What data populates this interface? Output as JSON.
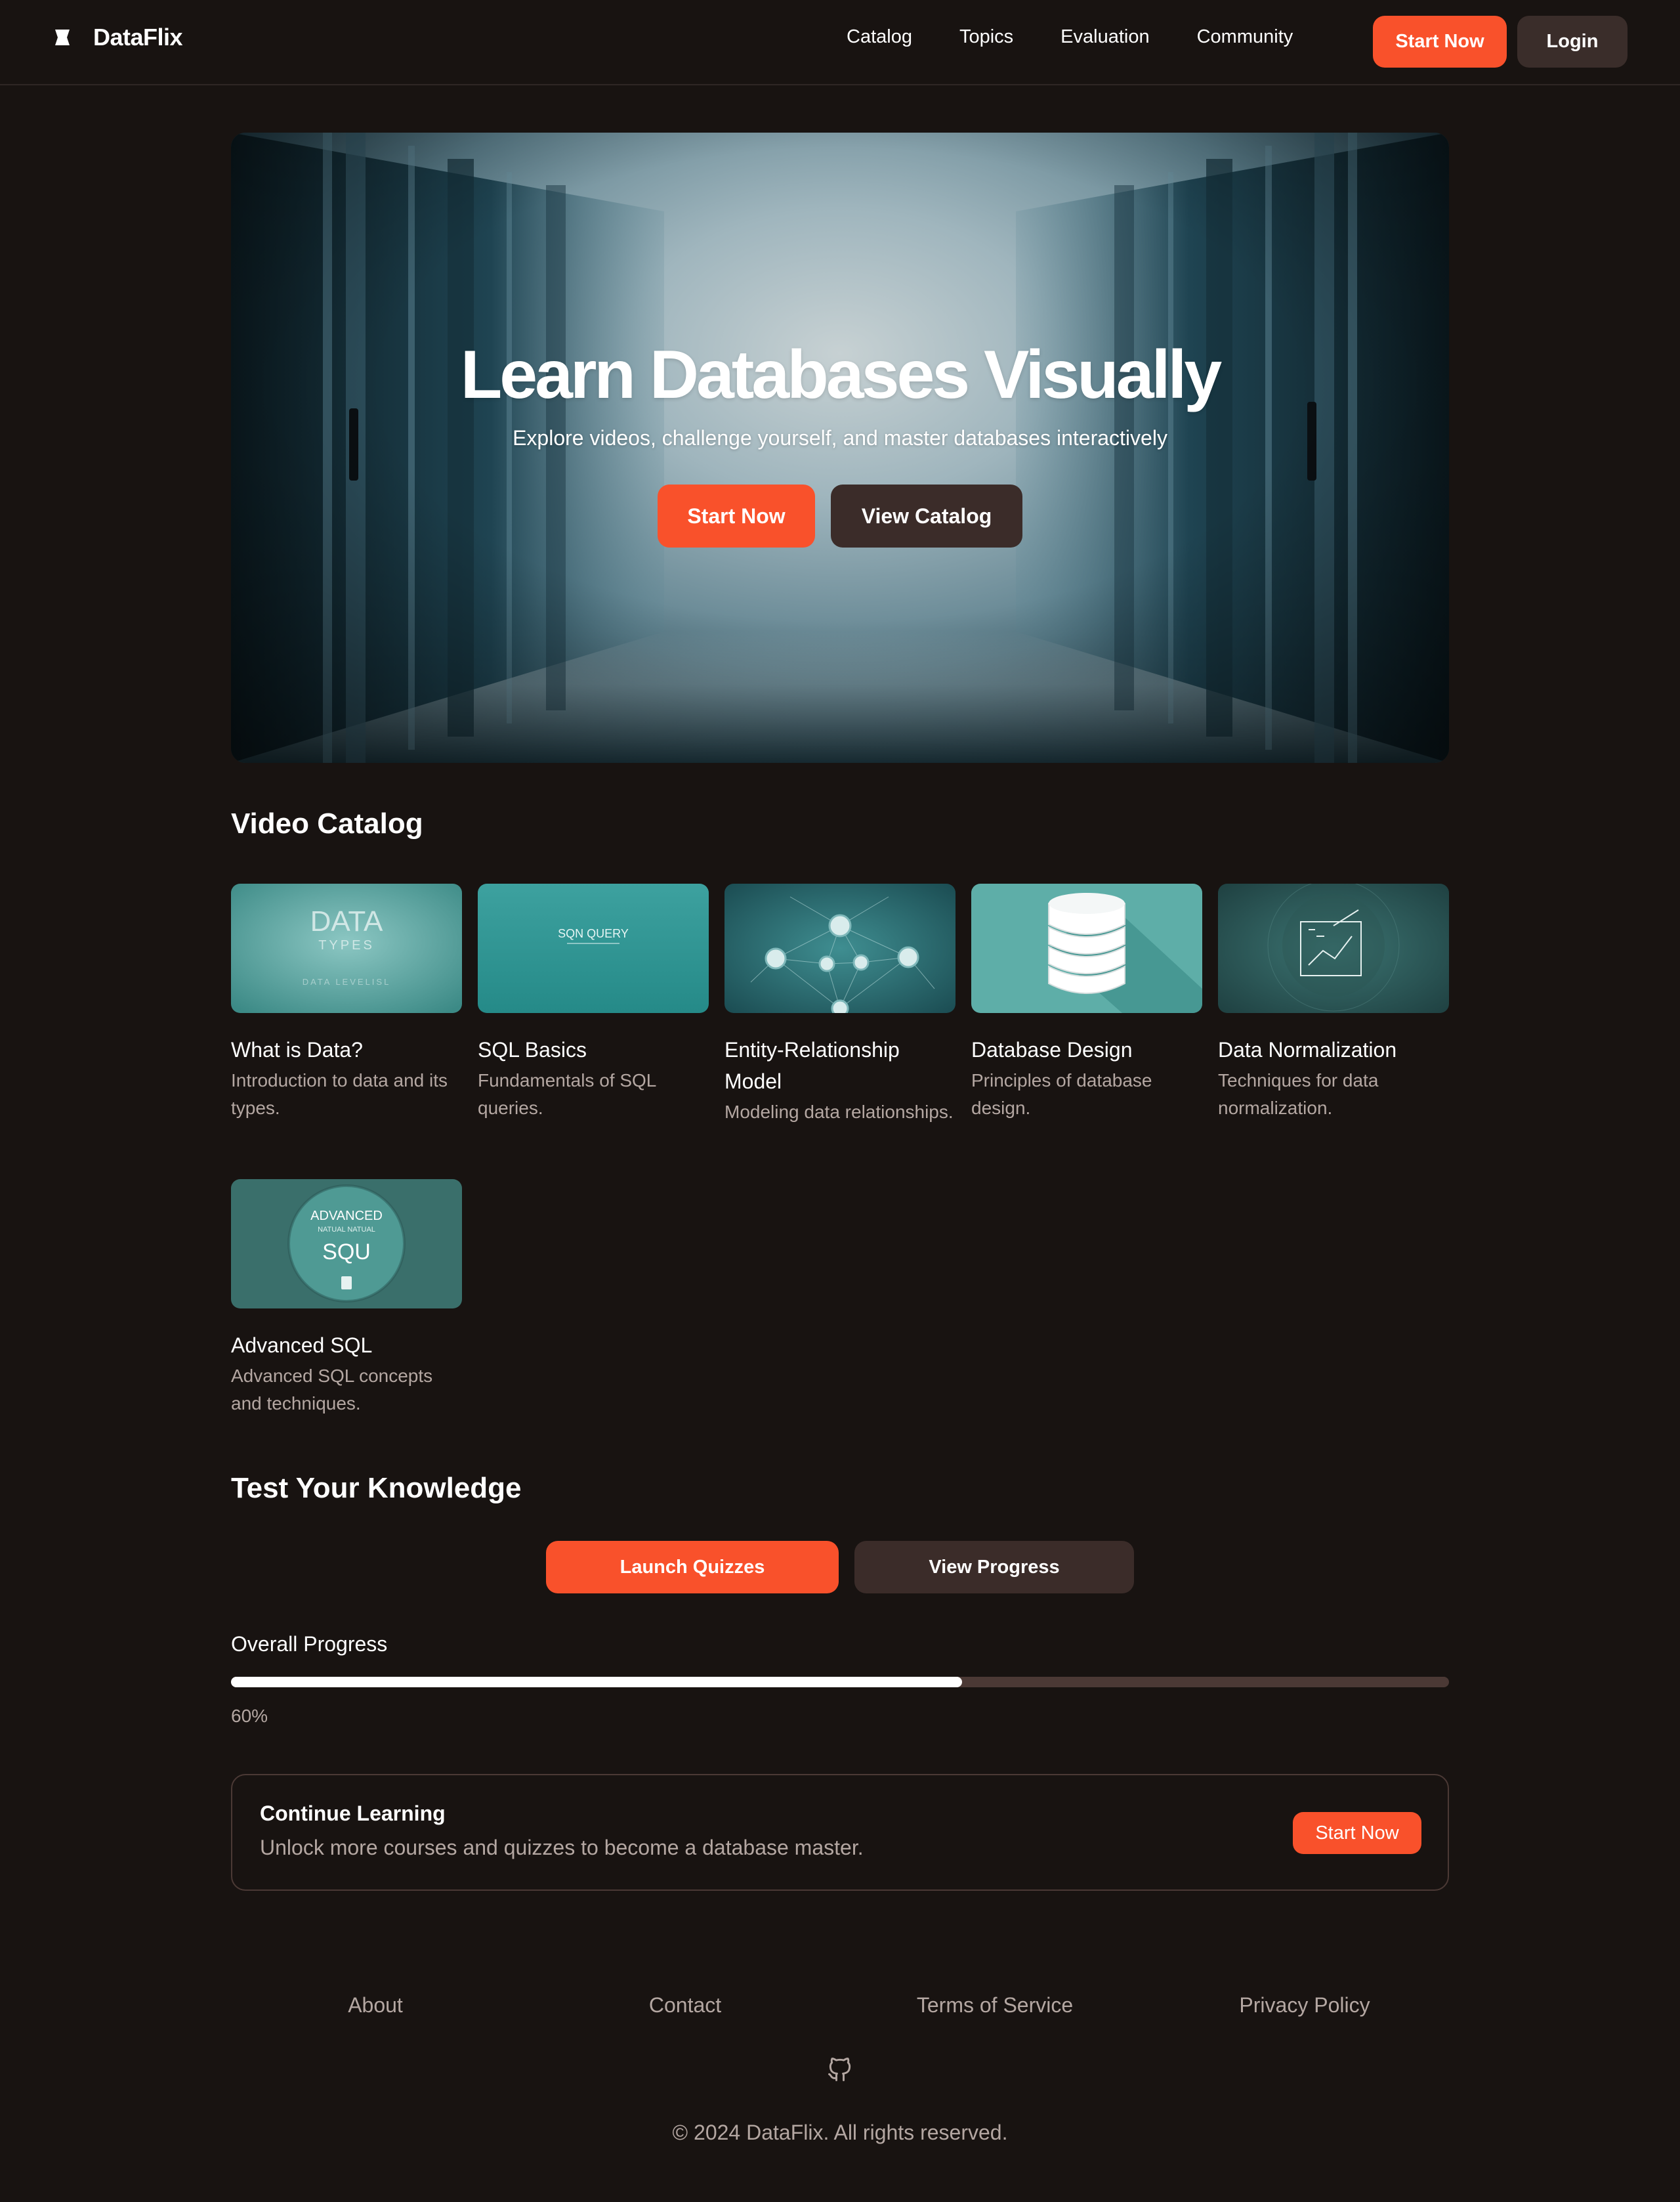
{
  "header": {
    "brand": "DataFlix",
    "nav": [
      "Catalog",
      "Topics",
      "Evaluation",
      "Community"
    ],
    "start_label": "Start Now",
    "login_label": "Login"
  },
  "hero": {
    "title": "Learn Databases Visually",
    "subtitle": "Explore videos, challenge yourself, and master databases interactively",
    "primary_label": "Start Now",
    "secondary_label": "View Catalog"
  },
  "catalog": {
    "title": "Video Catalog",
    "videos": [
      {
        "title": "What is Data?",
        "description": "Introduction to data and its types.",
        "thumb_text": [
          "DATA",
          "TYPES",
          "DATA LEVELISL"
        ]
      },
      {
        "title": "SQL Basics",
        "description": "Fundamentals of SQL queries.",
        "thumb_text": [
          "SQN QUERY"
        ]
      },
      {
        "title": "Entity-Relationship Model",
        "description": "Modeling data relationships."
      },
      {
        "title": "Database Design",
        "description": "Principles of database design."
      },
      {
        "title": "Data Normalization",
        "description": "Techniques for data normalization."
      },
      {
        "title": "Advanced SQL",
        "description": "Advanced SQL concepts and techniques.",
        "thumb_text": [
          "ADVANCED",
          "NATUAL NATUAL",
          "SQU"
        ]
      }
    ]
  },
  "quiz": {
    "title": "Test Your Knowledge",
    "launch_label": "Launch Quizzes",
    "progress_button_label": "View Progress"
  },
  "progress": {
    "label": "Overall Progress",
    "value": 0.6,
    "value_label": "60%"
  },
  "continue": {
    "title": "Continue Learning",
    "description": "Unlock more courses and quizzes to become a database master.",
    "button_label": "Start Now"
  },
  "footer": {
    "links": [
      "About",
      "Contact",
      "Terms of Service",
      "Privacy Policy"
    ],
    "icon": "github-icon",
    "copyright": "© 2024 DataFlix. All rights reserved."
  },
  "colors": {
    "background": "#181311",
    "accent": "#f9512b",
    "secondary_button": "#3b2c29",
    "muted_text": "#b4a7a2",
    "progress_track": "#4b3935"
  }
}
